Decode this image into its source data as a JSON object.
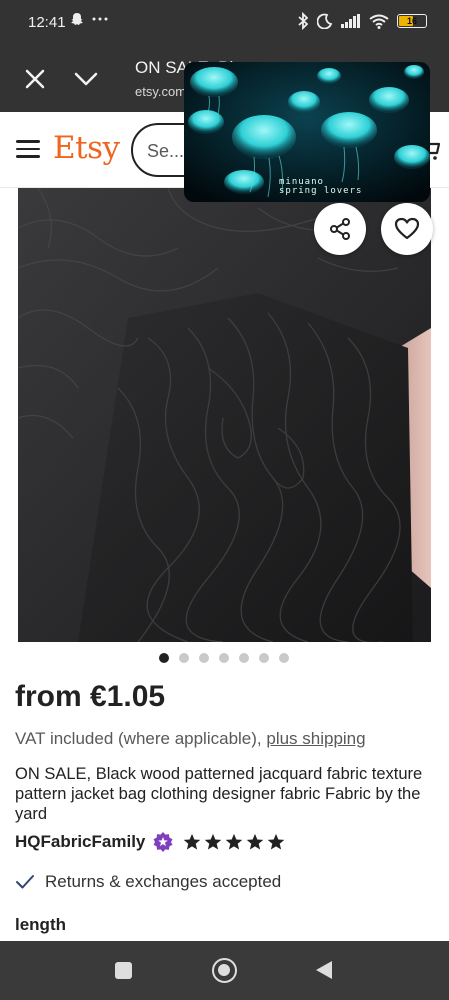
{
  "status_bar": {
    "time": "12:41",
    "battery_level": "16",
    "icons": [
      "snapchat-icon",
      "more-icon",
      "bluetooth-icon",
      "moon-icon",
      "signal-icon",
      "wifi-icon",
      "battery-icon"
    ]
  },
  "tab_bar": {
    "title": "ON SALE, Bl",
    "url": "etsy.com"
  },
  "header": {
    "logo": "Etsy",
    "search_placeholder": "Se..."
  },
  "pip_video": {
    "caption_line1": "minuano",
    "caption_line2": "spring lovers"
  },
  "product": {
    "image_count": 7,
    "active_image": 0,
    "price": "from €1.05",
    "vat_text": "VAT included (where applicable), ",
    "shipping_link": "plus shipping",
    "title": "ON SALE, Black wood patterned jacquard fabric texture pattern jacket bag clothing designer fabric Fabric by the yard",
    "shop_name": "HQFabricFamily",
    "rating_stars": 5,
    "returns_text": "Returns & exchanges accepted",
    "variation_label": "length"
  },
  "colors": {
    "brand": "#f1641e",
    "chrome": "#333333",
    "star_seller_badge": "#7f3fbf"
  }
}
